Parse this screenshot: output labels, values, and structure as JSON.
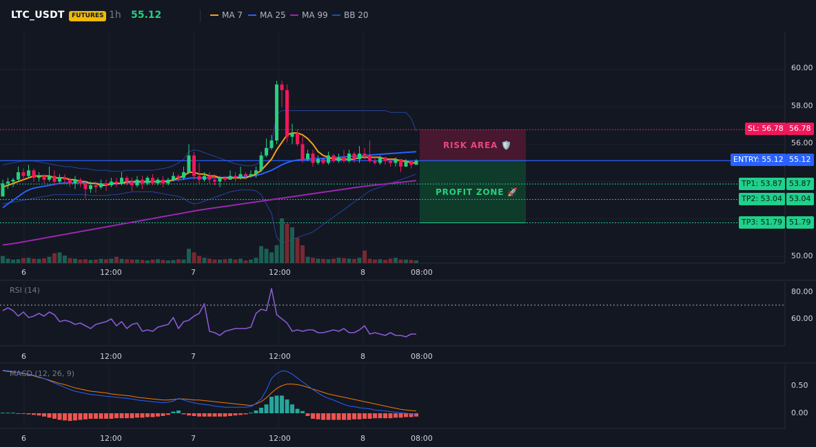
{
  "header": {
    "symbol": "LTC_USDT",
    "badge": "FUTURES",
    "timeframe": "1h",
    "last_price": "55.12",
    "legend": [
      {
        "label": "MA 7",
        "color": "#f7a21b"
      },
      {
        "label": "MA 25",
        "color": "#2962ff"
      },
      {
        "label": "MA 99",
        "color": "#9c27b0"
      },
      {
        "label": "BB 20",
        "color": "#1e4fb0"
      }
    ]
  },
  "price_axis": [
    "60.00",
    "58.00",
    "56.00",
    "50.00"
  ],
  "time_axis": [
    "6",
    "12:00",
    "7",
    "12:00",
    "8",
    "08:00"
  ],
  "levels": {
    "sl": {
      "label": "SL: 56.78",
      "value": "56.78"
    },
    "entry": {
      "label": "ENTRY: 55.12",
      "value": "55.12"
    },
    "tp1": {
      "label": "TP1: 53.87",
      "value": "53.87"
    },
    "tp2": {
      "label": "TP2: 53.04",
      "value": "53.04"
    },
    "tp3": {
      "label": "TP3: 51.79",
      "value": "51.79"
    }
  },
  "zones": {
    "risk": "RISK AREA 🛡️",
    "profit": "PROFIT ZONE 🚀"
  },
  "rsi": {
    "title": "RSI (14)",
    "axis": [
      "80.00",
      "60.00"
    ],
    "values": [
      66,
      68,
      66,
      62,
      65,
      61,
      62,
      64,
      62,
      65,
      63,
      58,
      59,
      58,
      56,
      57,
      55,
      53,
      56,
      57,
      58,
      60,
      55,
      58,
      53,
      56,
      57,
      51,
      52,
      51,
      54,
      55,
      56,
      61,
      53,
      58,
      59,
      62,
      64,
      71,
      51,
      50,
      48,
      51,
      52,
      53,
      53,
      53,
      54,
      64,
      67,
      66,
      82,
      63,
      60,
      57,
      51,
      52,
      51,
      52,
      52,
      50,
      50,
      51,
      52,
      51,
      53,
      50,
      50,
      52,
      55,
      49,
      50,
      49,
      48,
      50,
      48,
      48,
      47,
      49,
      49
    ]
  },
  "macd": {
    "title": "MACD (12, 26, 9)",
    "axis": [
      "0.50",
      "0.00"
    ],
    "macd": [
      0.78,
      0.77,
      0.76,
      0.74,
      0.73,
      0.71,
      0.69,
      0.66,
      0.63,
      0.59,
      0.55,
      0.51,
      0.47,
      0.43,
      0.4,
      0.38,
      0.36,
      0.34,
      0.33,
      0.32,
      0.31,
      0.3,
      0.29,
      0.28,
      0.27,
      0.26,
      0.24,
      0.23,
      0.22,
      0.21,
      0.2,
      0.19,
      0.2,
      0.22,
      0.27,
      0.24,
      0.21,
      0.19,
      0.17,
      0.16,
      0.15,
      0.13,
      0.12,
      0.11,
      0.11,
      0.11,
      0.11,
      0.11,
      0.12,
      0.18,
      0.26,
      0.42,
      0.63,
      0.72,
      0.77,
      0.76,
      0.71,
      0.64,
      0.57,
      0.5,
      0.43,
      0.37,
      0.31,
      0.27,
      0.24,
      0.2,
      0.16,
      0.13,
      0.12,
      0.1,
      0.09,
      0.08,
      0.06,
      0.05,
      0.04,
      0.03,
      0.02,
      0.01,
      0.0,
      -0.01,
      -0.02
    ],
    "signal": [
      0.77,
      0.76,
      0.75,
      0.74,
      0.72,
      0.7,
      0.68,
      0.65,
      0.63,
      0.6,
      0.57,
      0.54,
      0.52,
      0.49,
      0.46,
      0.44,
      0.42,
      0.4,
      0.39,
      0.38,
      0.37,
      0.35,
      0.34,
      0.33,
      0.32,
      0.31,
      0.29,
      0.28,
      0.27,
      0.26,
      0.25,
      0.24,
      0.24,
      0.25,
      0.26,
      0.26,
      0.25,
      0.24,
      0.24,
      0.23,
      0.22,
      0.21,
      0.2,
      0.19,
      0.18,
      0.17,
      0.16,
      0.15,
      0.14,
      0.17,
      0.21,
      0.28,
      0.37,
      0.45,
      0.5,
      0.53,
      0.53,
      0.52,
      0.5,
      0.47,
      0.44,
      0.41,
      0.38,
      0.35,
      0.33,
      0.31,
      0.29,
      0.27,
      0.25,
      0.23,
      0.21,
      0.19,
      0.17,
      0.15,
      0.13,
      0.11,
      0.09,
      0.07,
      0.06,
      0.05,
      0.04
    ],
    "hist": [
      0.01,
      0.01,
      0.01,
      0.0,
      -0.01,
      -0.02,
      -0.03,
      -0.04,
      -0.06,
      -0.08,
      -0.1,
      -0.12,
      -0.13,
      -0.14,
      -0.13,
      -0.12,
      -0.11,
      -0.1,
      -0.1,
      -0.1,
      -0.1,
      -0.1,
      -0.09,
      -0.09,
      -0.09,
      -0.09,
      -0.08,
      -0.08,
      -0.07,
      -0.07,
      -0.06,
      -0.05,
      -0.03,
      0.03,
      0.05,
      -0.02,
      -0.04,
      -0.05,
      -0.06,
      -0.06,
      -0.06,
      -0.06,
      -0.06,
      -0.06,
      -0.05,
      -0.04,
      -0.03,
      -0.02,
      0.01,
      0.05,
      0.1,
      0.16,
      0.3,
      0.32,
      0.32,
      0.25,
      0.16,
      0.08,
      0.04,
      -0.05,
      -0.1,
      -0.11,
      -0.12,
      -0.12,
      -0.12,
      -0.12,
      -0.12,
      -0.12,
      -0.11,
      -0.11,
      -0.1,
      -0.1,
      -0.09,
      -0.09,
      -0.09,
      -0.09,
      -0.08,
      -0.08,
      -0.07,
      -0.07,
      -0.06
    ]
  },
  "chart_data": {
    "type": "candlestick",
    "ylim": [
      49.5,
      61.2
    ],
    "candles": [
      [
        53.2,
        53.9,
        53.5,
        54.1
      ],
      [
        53.9,
        54.0,
        53.6,
        54.2
      ],
      [
        54.0,
        54.1,
        53.7,
        54.2
      ],
      [
        54.1,
        54.5,
        54.0,
        54.8
      ],
      [
        54.5,
        54.3,
        54.1,
        54.7
      ],
      [
        54.3,
        54.6,
        54.2,
        54.9
      ],
      [
        54.6,
        54.2,
        54.0,
        54.7
      ],
      [
        54.2,
        54.3,
        54.0,
        54.5
      ],
      [
        54.3,
        54.1,
        53.9,
        54.4
      ],
      [
        54.1,
        54.3,
        54.0,
        54.8
      ],
      [
        54.3,
        54.0,
        53.8,
        54.6
      ],
      [
        54.0,
        54.2,
        53.9,
        54.4
      ],
      [
        54.2,
        54.1,
        53.9,
        54.4
      ],
      [
        54.1,
        53.9,
        53.7,
        54.2
      ],
      [
        53.9,
        54.1,
        53.6,
        54.3
      ],
      [
        54.1,
        53.9,
        53.7,
        54.2
      ],
      [
        53.9,
        53.6,
        53.1,
        54.0
      ],
      [
        53.6,
        53.8,
        53.4,
        54.0
      ],
      [
        53.8,
        53.7,
        53.4,
        54.0
      ],
      [
        53.7,
        53.9,
        53.6,
        54.1
      ],
      [
        53.9,
        53.8,
        53.5,
        54.1
      ],
      [
        53.8,
        54.0,
        53.7,
        54.2
      ],
      [
        54.0,
        53.9,
        53.7,
        54.2
      ],
      [
        53.9,
        54.2,
        53.8,
        54.5
      ],
      [
        54.2,
        54.0,
        53.8,
        54.3
      ],
      [
        54.0,
        53.8,
        53.5,
        54.2
      ],
      [
        53.8,
        54.1,
        53.7,
        54.3
      ],
      [
        54.1,
        53.9,
        53.6,
        54.3
      ],
      [
        53.9,
        54.2,
        53.8,
        54.3
      ],
      [
        54.2,
        53.9,
        53.8,
        54.4
      ],
      [
        53.9,
        54.1,
        53.8,
        54.2
      ],
      [
        54.1,
        53.9,
        53.7,
        54.3
      ],
      [
        53.9,
        54.1,
        53.8,
        54.2
      ],
      [
        54.1,
        54.3,
        54.0,
        54.5
      ],
      [
        54.3,
        54.2,
        54.0,
        54.4
      ],
      [
        54.2,
        54.5,
        54.1,
        54.8
      ],
      [
        54.5,
        55.4,
        54.4,
        56.0
      ],
      [
        55.4,
        54.3,
        54.1,
        55.6
      ],
      [
        54.3,
        54.1,
        53.9,
        55.0
      ],
      [
        54.1,
        54.3,
        54.0,
        54.5
      ],
      [
        54.3,
        54.1,
        53.9,
        54.5
      ],
      [
        54.1,
        54.0,
        53.8,
        54.4
      ],
      [
        54.0,
        54.2,
        53.7,
        54.3
      ],
      [
        54.2,
        54.1,
        54.0,
        54.3
      ],
      [
        54.1,
        54.3,
        54.1,
        54.6
      ],
      [
        54.3,
        54.2,
        54.0,
        54.5
      ],
      [
        54.2,
        54.4,
        54.1,
        54.8
      ],
      [
        54.4,
        54.3,
        54.1,
        54.5
      ],
      [
        54.3,
        54.4,
        54.2,
        54.6
      ],
      [
        54.4,
        54.6,
        54.2,
        54.8
      ],
      [
        54.6,
        55.4,
        54.5,
        55.6
      ],
      [
        55.4,
        55.8,
        55.3,
        56.3
      ],
      [
        55.8,
        56.2,
        55.7,
        56.5
      ],
      [
        56.2,
        59.2,
        56.0,
        59.4
      ],
      [
        59.2,
        58.9,
        58.0,
        59.4
      ],
      [
        58.9,
        56.4,
        56.1,
        59.2
      ],
      [
        56.4,
        56.6,
        56.0,
        57.1
      ],
      [
        56.6,
        56.0,
        55.9,
        56.8
      ],
      [
        56.0,
        55.2,
        55.0,
        56.4
      ],
      [
        55.2,
        55.5,
        55.1,
        55.7
      ],
      [
        55.5,
        55.0,
        54.8,
        55.7
      ],
      [
        55.0,
        55.2,
        54.9,
        55.4
      ],
      [
        55.2,
        55.0,
        54.9,
        55.3
      ],
      [
        55.0,
        55.4,
        54.9,
        55.6
      ],
      [
        55.4,
        55.1,
        55.0,
        55.5
      ],
      [
        55.1,
        55.3,
        55.0,
        55.5
      ],
      [
        55.3,
        55.1,
        55.0,
        55.7
      ],
      [
        55.1,
        55.5,
        55.0,
        55.7
      ],
      [
        55.5,
        55.2,
        55.0,
        55.6
      ],
      [
        55.2,
        55.5,
        55.0,
        55.9
      ],
      [
        55.5,
        55.4,
        55.2,
        55.8
      ],
      [
        55.4,
        55.1,
        55.0,
        56.2
      ],
      [
        55.1,
        55.0,
        54.9,
        55.3
      ],
      [
        55.0,
        55.3,
        54.9,
        55.4
      ],
      [
        55.3,
        55.1,
        54.9,
        55.3
      ],
      [
        55.1,
        55.0,
        54.8,
        55.2
      ],
      [
        55.0,
        55.2,
        54.8,
        55.3
      ],
      [
        55.2,
        54.8,
        54.5,
        55.2
      ],
      [
        54.8,
        55.1,
        54.8,
        55.2
      ],
      [
        55.1,
        54.9,
        54.7,
        55.1
      ],
      [
        54.9,
        55.12,
        54.9,
        55.2
      ]
    ],
    "ma7": [
      53.7,
      53.8,
      53.9,
      54.0,
      54.1,
      54.2,
      54.3,
      54.3,
      54.3,
      54.3,
      54.2,
      54.2,
      54.2,
      54.1,
      54.1,
      54.0,
      54.0,
      53.9,
      53.9,
      53.8,
      53.8,
      53.9,
      53.9,
      53.9,
      54.0,
      54.0,
      54.0,
      54.0,
      54.0,
      54.0,
      54.0,
      54.0,
      54.0,
      54.1,
      54.2,
      54.3,
      54.5,
      54.5,
      54.4,
      54.4,
      54.3,
      54.3,
      54.2,
      54.2,
      54.2,
      54.2,
      54.2,
      54.2,
      54.3,
      54.4,
      54.6,
      54.9,
      55.2,
      55.7,
      56.1,
      56.5,
      56.6,
      56.6,
      56.5,
      56.3,
      56.0,
      55.6,
      55.4,
      55.3,
      55.2,
      55.2,
      55.2,
      55.2,
      55.2,
      55.3,
      55.3,
      55.3,
      55.3,
      55.3,
      55.2,
      55.2,
      55.2,
      55.1,
      55.1,
      55.0,
      55.0
    ],
    "ma25": [
      52.6,
      52.8,
      53.0,
      53.2,
      53.4,
      53.55,
      53.65,
      53.7,
      53.75,
      53.8,
      53.85,
      53.9,
      53.92,
      53.93,
      53.93,
      53.93,
      53.92,
      53.9,
      53.9,
      53.88,
      53.87,
      53.87,
      53.88,
      53.9,
      53.92,
      53.94,
      53.95,
      53.96,
      53.97,
      53.98,
      54.0,
      54.02,
      54.04,
      54.07,
      54.1,
      54.13,
      54.18,
      54.2,
      54.2,
      54.2,
      54.2,
      54.21,
      54.21,
      54.22,
      54.23,
      54.24,
      54.25,
      54.27,
      54.29,
      54.33,
      54.4,
      54.5,
      54.6,
      54.75,
      54.9,
      55.02,
      55.1,
      55.15,
      55.18,
      55.2,
      55.22,
      55.23,
      55.24,
      55.26,
      55.28,
      55.3,
      55.32,
      55.34,
      55.36,
      55.38,
      55.4,
      55.42,
      55.44,
      55.46,
      55.48,
      55.5,
      55.52,
      55.54,
      55.56,
      55.58,
      55.6
    ],
    "ma99": [
      50.6,
      50.64,
      50.68,
      50.72,
      50.77,
      50.82,
      50.87,
      50.92,
      50.97,
      51.02,
      51.07,
      51.12,
      51.17,
      51.22,
      51.27,
      51.32,
      51.37,
      51.42,
      51.47,
      51.52,
      51.57,
      51.62,
      51.67,
      51.72,
      51.77,
      51.82,
      51.87,
      51.92,
      51.97,
      52.02,
      52.07,
      52.12,
      52.17,
      52.22,
      52.27,
      52.32,
      52.37,
      52.42,
      52.47,
      52.51,
      52.55,
      52.59,
      52.63,
      52.67,
      52.71,
      52.75,
      52.79,
      52.83,
      52.87,
      52.91,
      52.95,
      52.99,
      53.03,
      53.07,
      53.11,
      53.15,
      53.19,
      53.23,
      53.27,
      53.31,
      53.35,
      53.39,
      53.43,
      53.47,
      53.51,
      53.55,
      53.59,
      53.63,
      53.67,
      53.71,
      53.75,
      53.78,
      53.81,
      53.84,
      53.87,
      53.9,
      53.93,
      53.96,
      53.99,
      54.02,
      54.05
    ],
    "bb_upper": [
      54.9,
      54.95,
      55.0,
      55.05,
      55.1,
      55.1,
      55.1,
      55.05,
      55.0,
      54.95,
      54.9,
      54.85,
      54.8,
      54.8,
      54.75,
      54.7,
      54.7,
      54.65,
      54.6,
      54.6,
      54.6,
      54.55,
      54.55,
      54.55,
      54.6,
      54.6,
      54.6,
      54.6,
      54.6,
      54.6,
      54.65,
      54.7,
      54.75,
      54.85,
      55.0,
      55.2,
      55.6,
      55.7,
      55.65,
      55.55,
      55.45,
      55.35,
      55.25,
      55.15,
      55.05,
      54.95,
      54.9,
      54.85,
      54.85,
      54.9,
      55.1,
      55.5,
      56.0,
      57.6,
      57.8,
      57.8,
      57.8,
      57.8,
      57.8,
      57.8,
      57.8,
      57.8,
      57.8,
      57.8,
      57.8,
      57.8,
      57.8,
      57.8,
      57.8,
      57.8,
      57.8,
      57.8,
      57.8,
      57.8,
      57.8,
      57.7,
      57.7,
      57.7,
      57.7,
      57.4,
      56.7
    ],
    "bb_lower": [
      52.8,
      52.85,
      52.9,
      52.95,
      53.0,
      53.05,
      53.1,
      53.15,
      53.2,
      53.25,
      53.3,
      53.3,
      53.3,
      53.3,
      53.3,
      53.3,
      53.3,
      53.25,
      53.25,
      53.25,
      53.25,
      53.3,
      53.3,
      53.35,
      53.4,
      53.45,
      53.45,
      53.45,
      53.45,
      53.45,
      53.4,
      53.35,
      53.3,
      53.25,
      53.2,
      53.1,
      52.9,
      52.8,
      52.85,
      52.95,
      53.05,
      53.15,
      53.25,
      53.35,
      53.45,
      53.5,
      53.55,
      53.55,
      53.55,
      53.5,
      53.3,
      52.8,
      52.3,
      51.0,
      50.7,
      50.8,
      50.9,
      51.0,
      51.1,
      51.2,
      51.3,
      51.5,
      51.7,
      51.9,
      52.1,
      52.3,
      52.5,
      52.7,
      52.9,
      53.1,
      53.3,
      53.5,
      53.6,
      53.7,
      53.8,
      53.9,
      54.0,
      54.1,
      54.2,
      54.3,
      54.4
    ],
    "volume": [
      40,
      25,
      20,
      22,
      28,
      30,
      25,
      24,
      27,
      35,
      55,
      60,
      42,
      28,
      25,
      20,
      22,
      18,
      20,
      24,
      22,
      25,
      35,
      24,
      22,
      20,
      20,
      18,
      15,
      20,
      22,
      18,
      15,
      17,
      22,
      20,
      80,
      60,
      40,
      30,
      25,
      20,
      20,
      22,
      25,
      20,
      25,
      15,
      20,
      30,
      95,
      80,
      60,
      100,
      250,
      220,
      200,
      140,
      100,
      35,
      30,
      25,
      24,
      22,
      25,
      30,
      28,
      25,
      24,
      30,
      70,
      24,
      20,
      22,
      18,
      25,
      30,
      20,
      20,
      18,
      15
    ],
    "volume_up": [
      true,
      true,
      true,
      true,
      false,
      true,
      false,
      true,
      false,
      true,
      false,
      true,
      true,
      false,
      true,
      false,
      false,
      true,
      false,
      true,
      false,
      true,
      false,
      true,
      false,
      false,
      true,
      false,
      true,
      false,
      true,
      false,
      true,
      true,
      false,
      true,
      true,
      false,
      false,
      true,
      false,
      false,
      true,
      false,
      true,
      false,
      true,
      false,
      true,
      true,
      true,
      true,
      true,
      true,
      true,
      false,
      true,
      false,
      false,
      true,
      false,
      true,
      false,
      true,
      false,
      true,
      false,
      true,
      false,
      true,
      false,
      false,
      false,
      true,
      false,
      false,
      true,
      false,
      true,
      false,
      true
    ]
  }
}
